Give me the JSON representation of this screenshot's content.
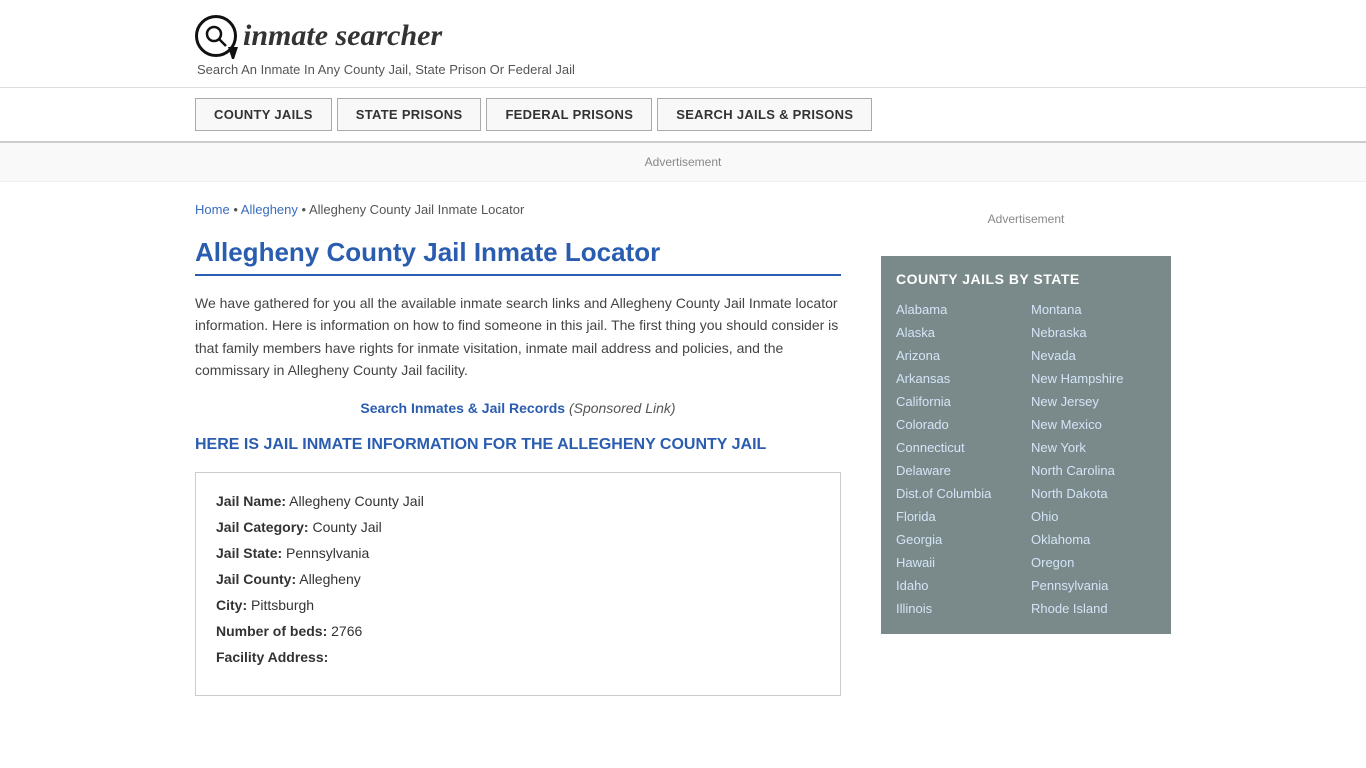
{
  "header": {
    "logo_symbol": "Q",
    "logo_text": "inmate searcher",
    "tagline": "Search An Inmate In Any County Jail, State Prison Or Federal Jail"
  },
  "nav": {
    "buttons": [
      {
        "id": "county-jails",
        "label": "COUNTY JAILS"
      },
      {
        "id": "state-prisons",
        "label": "STATE PRISONS"
      },
      {
        "id": "federal-prisons",
        "label": "FEDERAL PRISONS"
      },
      {
        "id": "search-jails",
        "label": "SEARCH JAILS & PRISONS"
      }
    ]
  },
  "ad_label": "Advertisement",
  "breadcrumb": {
    "home": "Home",
    "separator1": "•",
    "allegheny_link": "Allegheny",
    "separator2": "•",
    "current": "Allegheny County Jail Inmate Locator"
  },
  "page": {
    "title": "Allegheny County Jail Inmate Locator",
    "description": "We have gathered for you all the available inmate search links and Allegheny County Jail Inmate locator information. Here is information on how to find someone in this jail. The first thing you should consider is that family members have rights for inmate visitation, inmate mail address and policies, and the commissary in Allegheny County Jail facility.",
    "sponsored_link_text": "Search Inmates & Jail Records",
    "sponsored_link_suffix": "(Sponsored Link)",
    "section_heading": "HERE IS JAIL INMATE INFORMATION FOR THE ALLEGHENY COUNTY JAIL"
  },
  "jail_info": {
    "name_label": "Jail Name:",
    "name_value": "Allegheny County Jail",
    "category_label": "Jail Category:",
    "category_value": "County Jail",
    "state_label": "Jail State:",
    "state_value": "Pennsylvania",
    "county_label": "Jail County:",
    "county_value": "Allegheny",
    "city_label": "City:",
    "city_value": "Pittsburgh",
    "beds_label": "Number of beds:",
    "beds_value": "2766",
    "address_label": "Facility Address:"
  },
  "sidebar": {
    "ad_label": "Advertisement",
    "box_title": "COUNTY JAILS BY STATE",
    "states_col1": [
      "Alabama",
      "Alaska",
      "Arizona",
      "Arkansas",
      "California",
      "Colorado",
      "Connecticut",
      "Delaware",
      "Dist.of Columbia",
      "Florida",
      "Georgia",
      "Hawaii",
      "Idaho",
      "Illinois"
    ],
    "states_col2": [
      "Montana",
      "Nebraska",
      "Nevada",
      "New Hampshire",
      "New Jersey",
      "New Mexico",
      "New York",
      "North Carolina",
      "North Dakota",
      "Ohio",
      "Oklahoma",
      "Oregon",
      "Pennsylvania",
      "Rhode Island"
    ]
  }
}
